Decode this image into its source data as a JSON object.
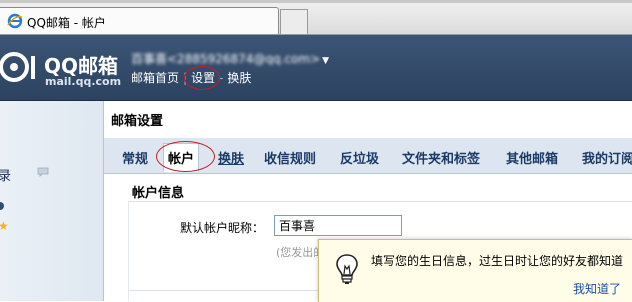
{
  "browser": {
    "tab_title": "QQ邮箱 - 帐户",
    "icons": {
      "tab_icon": "ie-icon"
    }
  },
  "header": {
    "logo_brand": "QQ邮箱",
    "logo_domain": "mail.qq.com",
    "user_display": "百事喜<2885926874@qq.com>",
    "links": {
      "home": "邮箱首页",
      "settings": "设置",
      "skin": "换肤"
    },
    "colors": {
      "bar": "#34496a"
    }
  },
  "sidebar": {
    "label": "录",
    "icons": [
      "chat-bubble-icon",
      "status-dot-icon",
      "star-icon"
    ]
  },
  "main": {
    "page_title": "邮箱设置",
    "tabs": [
      {
        "label": "常规"
      },
      {
        "label": "帐户"
      },
      {
        "label": "换肤"
      },
      {
        "label": "收信规则"
      },
      {
        "label": "反垃圾"
      },
      {
        "label": "文件夹和标签"
      },
      {
        "label": "其他邮箱"
      },
      {
        "label": "我的订阅"
      }
    ],
    "active_tab": "帐户",
    "section_title": "帐户信息",
    "nickname": {
      "label": "默认帐户昵称：",
      "value": "百事喜",
      "hint": "(您发出的"
    }
  },
  "tip": {
    "text": "填写您的生日信息，过生日时让您的好友都知道",
    "ok_label": "我知道了",
    "icon": "lightbulb-icon"
  },
  "colors": {
    "highlight_circle": "#c42020",
    "link": "#1b4fa2"
  }
}
